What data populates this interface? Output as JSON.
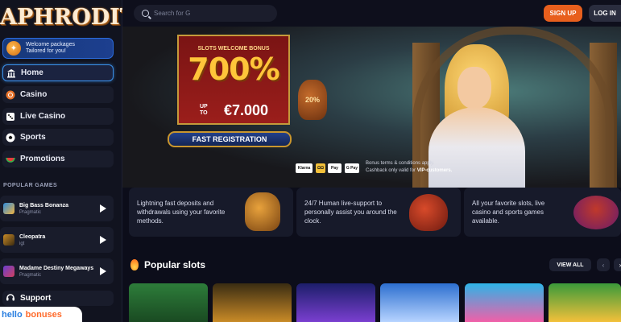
{
  "sidebar": {
    "logo": "APHRODITE",
    "welcome": {
      "line1": "Welcome packages",
      "line2": "Tailored for you!"
    },
    "nav": [
      {
        "label": "Home",
        "icon": "temple-icon"
      },
      {
        "label": "Casino",
        "icon": "chip-icon"
      },
      {
        "label": "Live Casino",
        "icon": "dice-icon"
      },
      {
        "label": "Sports",
        "icon": "soccer-ball-icon"
      },
      {
        "label": "Promotions",
        "icon": "watermelon-icon"
      }
    ],
    "popular_games_title": "POPULAR GAMES",
    "games": [
      {
        "name": "Big Bass Bonanza",
        "provider": "Pragmatic"
      },
      {
        "name": "Cleopatra",
        "provider": "igt"
      },
      {
        "name": "Madame Destiny Megaways",
        "provider": "Pragmatic"
      }
    ],
    "support": "Support"
  },
  "header": {
    "search_placeholder": "Search for G",
    "signup": "SIGN UP",
    "login": "LOG IN"
  },
  "hero": {
    "banner_title": "SLOTS WELCOME BONUS",
    "percent": "700%",
    "up": "UP",
    "to": "TO",
    "amount": "€7.000",
    "vase_text": "20%",
    "cta": "FAST REGISTRATION",
    "payments": [
      "Klarna",
      "ΩΩ",
      "Pay",
      "G Pay"
    ],
    "terms_line1": "Bonus terms & conditions apply.",
    "terms_line2_prefix": "Cashback only valid for ",
    "terms_line2_bold": "VIP-customers."
  },
  "features": [
    {
      "line1": "Lightning fast deposits and",
      "line2": "withdrawals using your favorite",
      "line3": "methods."
    },
    {
      "line1": "24/7 Human live-support to",
      "line2": "personally assist you around the",
      "line3": "clock."
    },
    {
      "line1": "All your favorite slots, live",
      "line2": "casino and sports games",
      "line3": "available."
    }
  ],
  "popular_slots": {
    "title": "Popular slots",
    "view_all": "VIEW ALL",
    "prev": "‹",
    "next": "›"
  },
  "watermark": {
    "part1": "hello",
    "part2": "bonuses"
  },
  "colors": {
    "accent": "#e85f1d",
    "brand_gold": "#ffc53a",
    "active_border": "#3a8fe8"
  }
}
